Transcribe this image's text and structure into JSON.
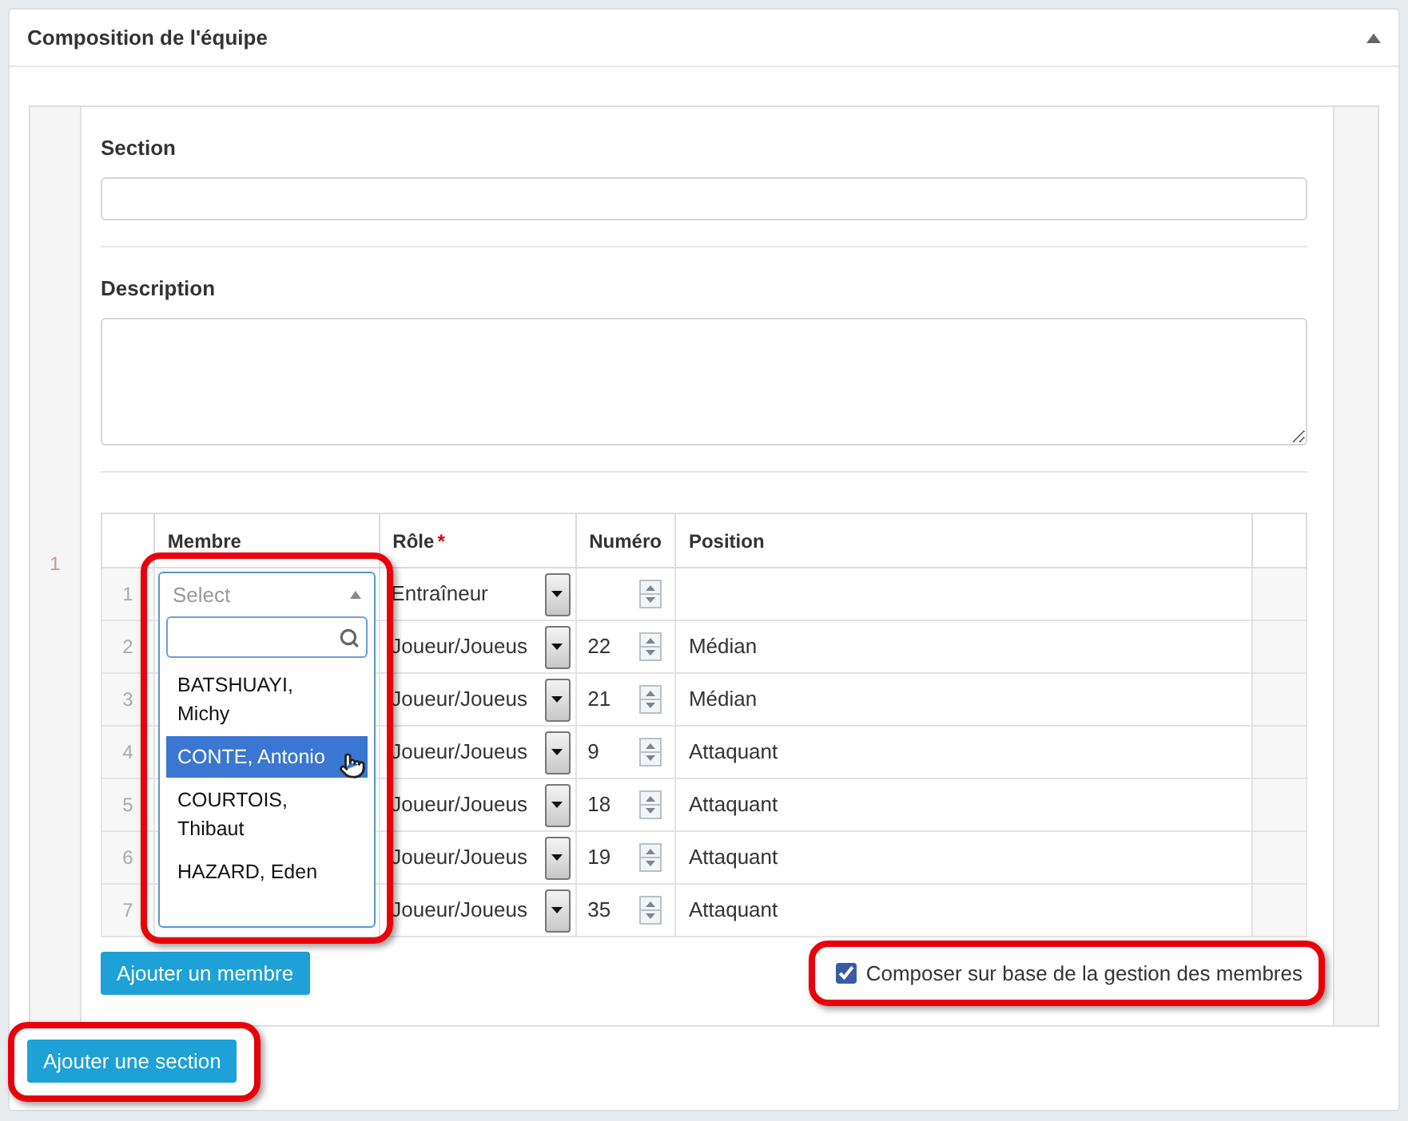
{
  "panel": {
    "title": "Composition de l'équipe"
  },
  "section_group": {
    "index": "1",
    "fields": [
      {
        "label": "Section",
        "kind": "input"
      },
      {
        "label": "Description",
        "kind": "textarea"
      }
    ],
    "table": {
      "columns": [
        {
          "label": "Membre",
          "required": false
        },
        {
          "label": "Rôle",
          "required": true,
          "required_mark": "*"
        },
        {
          "label": "Numéro",
          "required": false
        },
        {
          "label": "Position",
          "required": false
        }
      ],
      "rows": [
        {
          "number": "1",
          "role": "Entraîneur"
        },
        {
          "number": "2",
          "role": "Joueur/Joueus",
          "numero": "22",
          "position": "Médian"
        },
        {
          "number": "3",
          "role": "Joueur/Joueus",
          "numero": "21",
          "position": "Médian"
        },
        {
          "number": "4",
          "role": "Joueur/Joueus",
          "numero": "9",
          "position": "Attaquant"
        },
        {
          "number": "5",
          "role": "Joueur/Joueus",
          "numero": "18",
          "position": "Attaquant"
        },
        {
          "number": "6",
          "role": "Joueur/Joueus",
          "numero": "19",
          "position": "Attaquant"
        },
        {
          "number": "7",
          "role": "Joueur/Joueus",
          "numero": "35",
          "position": "Attaquant"
        }
      ]
    },
    "member_dropdown": {
      "placeholder": "Select",
      "options": [
        {
          "label": "BATSHUAYI, Michy",
          "selected": false
        },
        {
          "label": "CONTE, Antonio",
          "selected": true
        },
        {
          "label": "COURTOIS, Thibaut",
          "selected": false
        },
        {
          "label": "HAZARD, Eden",
          "selected": false
        }
      ]
    },
    "add_member_button": "Ajouter un membre",
    "checkbox": {
      "label": "Composer sur base de la gestion des membres",
      "checked": true
    }
  },
  "add_section_button": "Ajouter une section"
}
